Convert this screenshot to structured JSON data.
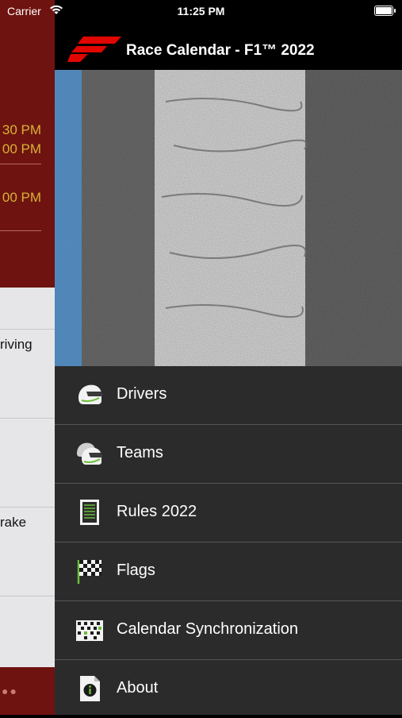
{
  "status_bar": {
    "carrier": "Carrier",
    "time": "11:25 PM"
  },
  "underlying": {
    "times": [
      "30 PM",
      "00 PM",
      "00 PM"
    ],
    "words": [
      "riving",
      "rake"
    ]
  },
  "header": {
    "title": "Race Calendar - F1™ 2022"
  },
  "menu": [
    {
      "label": "Drivers",
      "icon": "helmet-icon"
    },
    {
      "label": "Teams",
      "icon": "two-helmets-icon"
    },
    {
      "label": "Rules 2022",
      "icon": "rulebook-icon"
    },
    {
      "label": "Flags",
      "icon": "checkered-flag-icon"
    },
    {
      "label": "Calendar Synchronization",
      "icon": "calendar-icon"
    },
    {
      "label": "About",
      "icon": "info-document-icon"
    }
  ],
  "colors": {
    "underlying_red": "#6e130f",
    "drawer_bg": "#2b2b2b",
    "header_bg": "#000000",
    "time_gold": "#d9b237",
    "accent_green": "#6bbf3a"
  }
}
